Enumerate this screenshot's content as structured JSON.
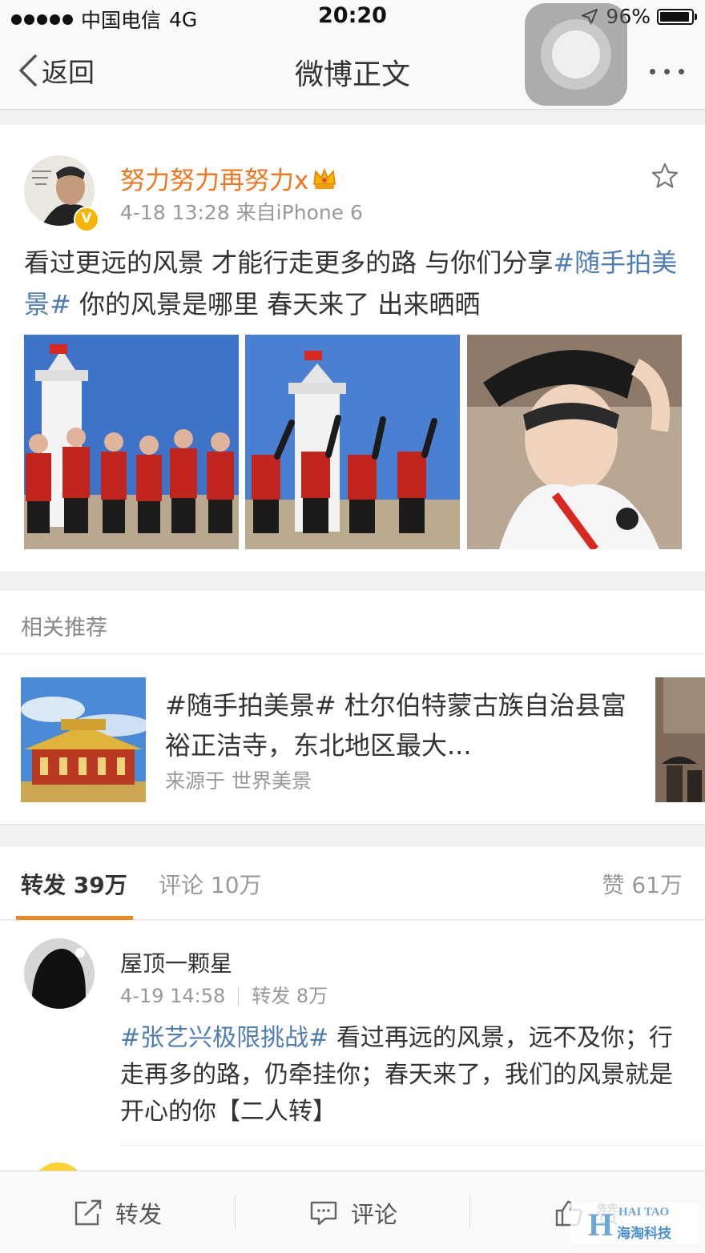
{
  "status_bar": {
    "carrier": "中国电信",
    "network": "4G",
    "time": "20:20",
    "battery": "96%"
  },
  "nav": {
    "back_label": "返回",
    "title": "微博正文"
  },
  "post": {
    "author": "努力努力再努力x",
    "verified_badge": "V",
    "meta": "4-18 13:28  来自iPhone 6",
    "text_part1": "看过更远的风景 才能行走更多的路 与你们分享",
    "hashtag": "#随手拍美景#",
    "text_part2": " 你的风景是哪里 春天来了 出来晒晒"
  },
  "related": {
    "label": "相关推荐",
    "title": "#随手拍美景# 杜尔伯特蒙古族自治县富裕正洁寺，东北地区最大...",
    "source": "来源于 世界美景"
  },
  "tabs": {
    "repost": "转发 39万",
    "comment": "评论 10万",
    "like": "赞 61万"
  },
  "repost_item": {
    "name": "屋顶一颗星",
    "date": "4-19 14:58",
    "repost_count": "转发 8万",
    "hashtag": "#张艺兴极限挑战#",
    "text": " 看过再远的风景，远不及你；行走再多的路，仍牵挂你；春天来了，我们的风景就是开心的你【二人转】"
  },
  "bottom_bar": {
    "repost": "转发",
    "comment": "评论",
    "like": "赞"
  },
  "watermark": {
    "en": "HAI TAO",
    "cn": "海淘科技",
    "letter": "H"
  },
  "colors": {
    "accent_orange": "#f0751e",
    "tab_underline": "#f08a20",
    "hashtag_blue": "#4f7db3",
    "verified_gold": "#f7b500"
  }
}
